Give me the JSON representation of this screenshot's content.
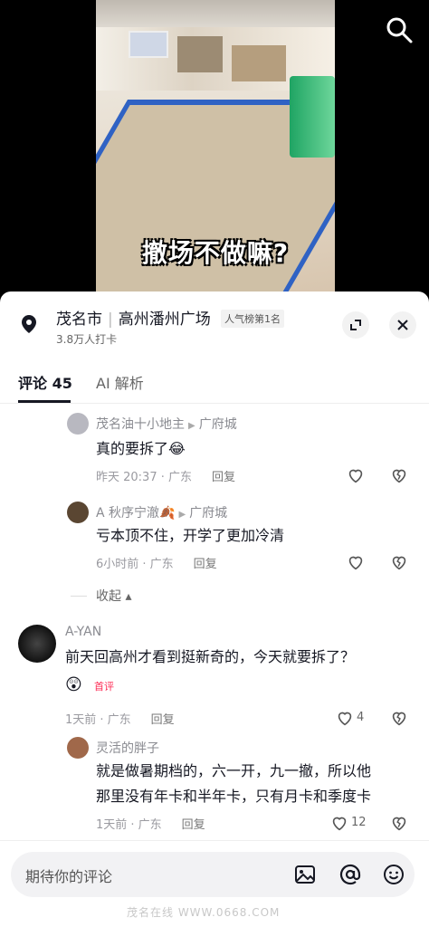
{
  "video": {
    "caption": "撤场不做嘛?"
  },
  "icons": {
    "search": "search-icon",
    "location": "location-pin-icon",
    "expand": "expand-icon",
    "close": "close-icon",
    "like": "heart-icon",
    "dislike": "broken-heart-icon",
    "image": "image-icon",
    "mention": "at-icon",
    "emoji": "emoji-icon"
  },
  "location": {
    "city": "茂名市",
    "place": "高州潘州广场",
    "rank": "人气榜第1名",
    "checkins": "3.8万人打卡"
  },
  "tabs": {
    "comments": "评论 45",
    "ai": "AI 解析"
  },
  "comments": [
    {
      "user": "茂名油十小地主",
      "reply_to": "广府城",
      "text": "真的要拆了😂",
      "time": "昨天 20:37 · 广东",
      "reply": "回复"
    },
    {
      "user": "A 秋序宁澈🍂",
      "reply_to": "广府城",
      "text": "亏本顶不住，开学了更加冷清",
      "time": "6小时前 · 广东",
      "reply": "回复"
    },
    {
      "user": "A-YAN",
      "text": "前天回高州才看到挺新奇的，今天就要拆了？",
      "emoji_badge": "首评",
      "time": "1天前 · 广东",
      "reply": "回复",
      "likes": "4"
    },
    {
      "user": "灵活的胖子",
      "text_line1": "就是做暑期档的，六一开，九一撤，所以他",
      "text_line2": "那里没有年卡和半年卡，只有月卡和季度卡",
      "time": "1天前 · 广东",
      "reply": "回复",
      "likes": "12"
    }
  ],
  "collapse_label": "收起",
  "input": {
    "placeholder": "期待你的评论"
  },
  "watermark": "茂名在线 WWW.0668.COM"
}
